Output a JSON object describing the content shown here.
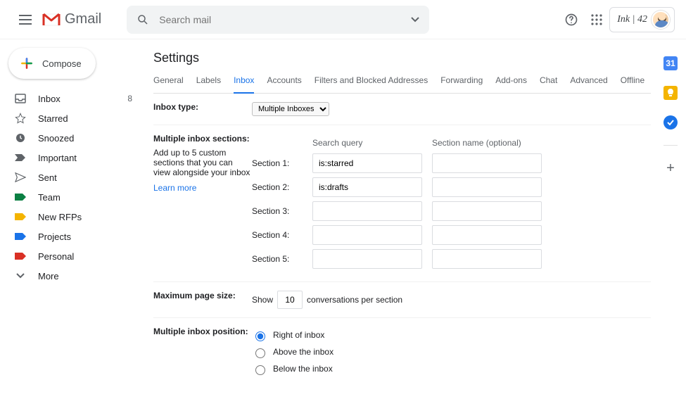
{
  "app": {
    "name": "Gmail"
  },
  "search": {
    "placeholder": "Search mail"
  },
  "account": {
    "label": "Ink | 42"
  },
  "compose": {
    "label": "Compose"
  },
  "sidebar": {
    "items": [
      {
        "label": "Inbox",
        "count": "8",
        "iconColor": "#5f6368",
        "shape": "inbox"
      },
      {
        "label": "Starred",
        "count": "",
        "iconColor": "#5f6368",
        "shape": "star"
      },
      {
        "label": "Snoozed",
        "count": "",
        "iconColor": "#5f6368",
        "shape": "clock"
      },
      {
        "label": "Important",
        "count": "",
        "iconColor": "#5f6368",
        "shape": "important"
      },
      {
        "label": "Sent",
        "count": "",
        "iconColor": "#5f6368",
        "shape": "send"
      },
      {
        "label": "Team",
        "count": "",
        "iconColor": "#0b8043",
        "shape": "tag"
      },
      {
        "label": "New RFPs",
        "count": "",
        "iconColor": "#f4b400",
        "shape": "tag"
      },
      {
        "label": "Projects",
        "count": "",
        "iconColor": "#1a73e8",
        "shape": "tag"
      },
      {
        "label": "Personal",
        "count": "",
        "iconColor": "#d93025",
        "shape": "tag"
      },
      {
        "label": "More",
        "count": "",
        "iconColor": "#5f6368",
        "shape": "more"
      }
    ]
  },
  "settings": {
    "title": "Settings",
    "tabs": [
      "General",
      "Labels",
      "Inbox",
      "Accounts",
      "Filters and Blocked Addresses",
      "Forwarding",
      "Add-ons",
      "Chat",
      "Advanced",
      "Offline"
    ],
    "activeTabIndex": 2,
    "inboxType": {
      "label": "Inbox type:",
      "value": "Multiple Inboxes"
    },
    "sections": {
      "label": "Multiple inbox sections:",
      "sub": "Add up to 5 custom sections that you can view alongside your inbox",
      "learnMore": "Learn more",
      "queryHeader": "Search query",
      "nameHeader": "Section name (optional)",
      "rows": [
        {
          "label": "Section 1:",
          "query": "is:starred",
          "name": ""
        },
        {
          "label": "Section 2:",
          "query": "is:drafts",
          "name": ""
        },
        {
          "label": "Section 3:",
          "query": "",
          "name": ""
        },
        {
          "label": "Section 4:",
          "query": "",
          "name": ""
        },
        {
          "label": "Section 5:",
          "query": "",
          "name": ""
        }
      ]
    },
    "pageSize": {
      "label": "Maximum page size:",
      "prefix": "Show",
      "value": "10",
      "suffix": "conversations per section"
    },
    "position": {
      "label": "Multiple inbox position:",
      "options": [
        "Right of inbox",
        "Above the inbox",
        "Below the inbox"
      ],
      "selectedIndex": 0
    }
  }
}
